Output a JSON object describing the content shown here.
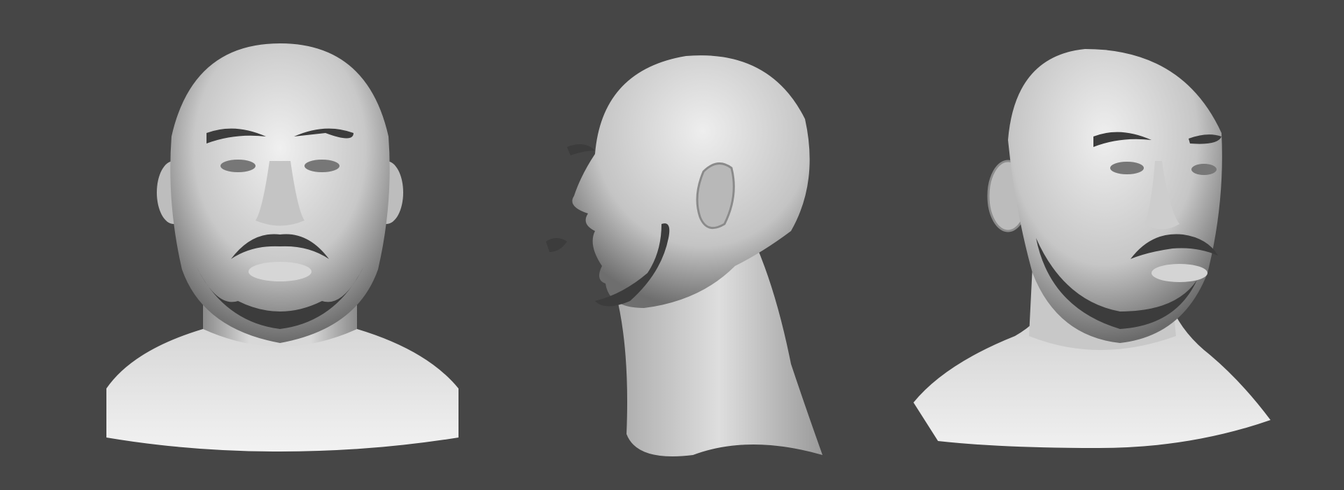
{
  "scene": {
    "background_color": "#464646",
    "clay_light_color": "#e6e6e6",
    "clay_mid_color": "#b4b4b4",
    "clay_dark_color": "#5a5a5a",
    "hair_color": "#3c3c3c",
    "views": [
      {
        "id": "front",
        "model": "head-bust-sculpt"
      },
      {
        "id": "profile-left",
        "model": "head-bust-sculpt"
      },
      {
        "id": "three-quarter-right",
        "model": "head-bust-sculpt"
      }
    ]
  }
}
